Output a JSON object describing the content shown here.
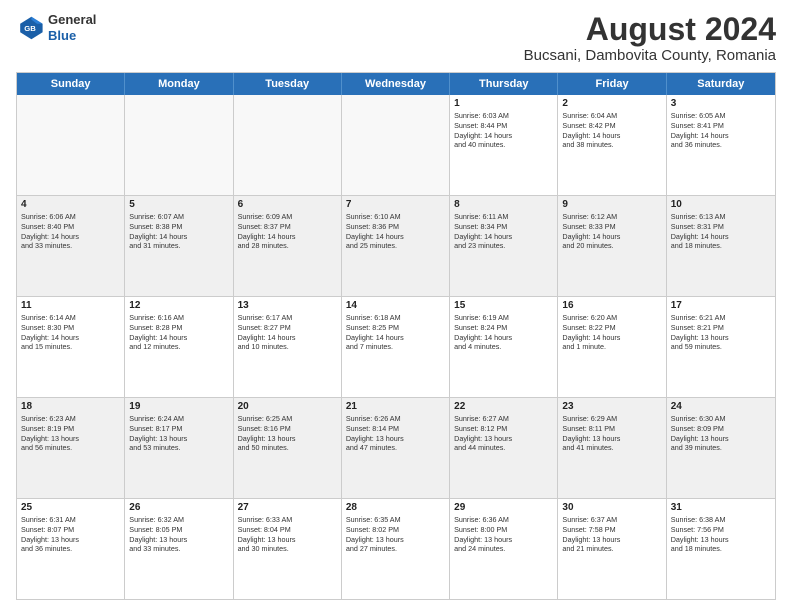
{
  "logo": {
    "line1": "General",
    "line2": "Blue"
  },
  "title": "August 2024",
  "subtitle": "Bucsani, Dambovita County, Romania",
  "header_days": [
    "Sunday",
    "Monday",
    "Tuesday",
    "Wednesday",
    "Thursday",
    "Friday",
    "Saturday"
  ],
  "weeks": [
    [
      {
        "day": "",
        "info": ""
      },
      {
        "day": "",
        "info": ""
      },
      {
        "day": "",
        "info": ""
      },
      {
        "day": "",
        "info": ""
      },
      {
        "day": "1",
        "info": "Sunrise: 6:03 AM\nSunset: 8:44 PM\nDaylight: 14 hours\nand 40 minutes."
      },
      {
        "day": "2",
        "info": "Sunrise: 6:04 AM\nSunset: 8:42 PM\nDaylight: 14 hours\nand 38 minutes."
      },
      {
        "day": "3",
        "info": "Sunrise: 6:05 AM\nSunset: 8:41 PM\nDaylight: 14 hours\nand 36 minutes."
      }
    ],
    [
      {
        "day": "4",
        "info": "Sunrise: 6:06 AM\nSunset: 8:40 PM\nDaylight: 14 hours\nand 33 minutes."
      },
      {
        "day": "5",
        "info": "Sunrise: 6:07 AM\nSunset: 8:38 PM\nDaylight: 14 hours\nand 31 minutes."
      },
      {
        "day": "6",
        "info": "Sunrise: 6:09 AM\nSunset: 8:37 PM\nDaylight: 14 hours\nand 28 minutes."
      },
      {
        "day": "7",
        "info": "Sunrise: 6:10 AM\nSunset: 8:36 PM\nDaylight: 14 hours\nand 25 minutes."
      },
      {
        "day": "8",
        "info": "Sunrise: 6:11 AM\nSunset: 8:34 PM\nDaylight: 14 hours\nand 23 minutes."
      },
      {
        "day": "9",
        "info": "Sunrise: 6:12 AM\nSunset: 8:33 PM\nDaylight: 14 hours\nand 20 minutes."
      },
      {
        "day": "10",
        "info": "Sunrise: 6:13 AM\nSunset: 8:31 PM\nDaylight: 14 hours\nand 18 minutes."
      }
    ],
    [
      {
        "day": "11",
        "info": "Sunrise: 6:14 AM\nSunset: 8:30 PM\nDaylight: 14 hours\nand 15 minutes."
      },
      {
        "day": "12",
        "info": "Sunrise: 6:16 AM\nSunset: 8:28 PM\nDaylight: 14 hours\nand 12 minutes."
      },
      {
        "day": "13",
        "info": "Sunrise: 6:17 AM\nSunset: 8:27 PM\nDaylight: 14 hours\nand 10 minutes."
      },
      {
        "day": "14",
        "info": "Sunrise: 6:18 AM\nSunset: 8:25 PM\nDaylight: 14 hours\nand 7 minutes."
      },
      {
        "day": "15",
        "info": "Sunrise: 6:19 AM\nSunset: 8:24 PM\nDaylight: 14 hours\nand 4 minutes."
      },
      {
        "day": "16",
        "info": "Sunrise: 6:20 AM\nSunset: 8:22 PM\nDaylight: 14 hours\nand 1 minute."
      },
      {
        "day": "17",
        "info": "Sunrise: 6:21 AM\nSunset: 8:21 PM\nDaylight: 13 hours\nand 59 minutes."
      }
    ],
    [
      {
        "day": "18",
        "info": "Sunrise: 6:23 AM\nSunset: 8:19 PM\nDaylight: 13 hours\nand 56 minutes."
      },
      {
        "day": "19",
        "info": "Sunrise: 6:24 AM\nSunset: 8:17 PM\nDaylight: 13 hours\nand 53 minutes."
      },
      {
        "day": "20",
        "info": "Sunrise: 6:25 AM\nSunset: 8:16 PM\nDaylight: 13 hours\nand 50 minutes."
      },
      {
        "day": "21",
        "info": "Sunrise: 6:26 AM\nSunset: 8:14 PM\nDaylight: 13 hours\nand 47 minutes."
      },
      {
        "day": "22",
        "info": "Sunrise: 6:27 AM\nSunset: 8:12 PM\nDaylight: 13 hours\nand 44 minutes."
      },
      {
        "day": "23",
        "info": "Sunrise: 6:29 AM\nSunset: 8:11 PM\nDaylight: 13 hours\nand 41 minutes."
      },
      {
        "day": "24",
        "info": "Sunrise: 6:30 AM\nSunset: 8:09 PM\nDaylight: 13 hours\nand 39 minutes."
      }
    ],
    [
      {
        "day": "25",
        "info": "Sunrise: 6:31 AM\nSunset: 8:07 PM\nDaylight: 13 hours\nand 36 minutes."
      },
      {
        "day": "26",
        "info": "Sunrise: 6:32 AM\nSunset: 8:05 PM\nDaylight: 13 hours\nand 33 minutes."
      },
      {
        "day": "27",
        "info": "Sunrise: 6:33 AM\nSunset: 8:04 PM\nDaylight: 13 hours\nand 30 minutes."
      },
      {
        "day": "28",
        "info": "Sunrise: 6:35 AM\nSunset: 8:02 PM\nDaylight: 13 hours\nand 27 minutes."
      },
      {
        "day": "29",
        "info": "Sunrise: 6:36 AM\nSunset: 8:00 PM\nDaylight: 13 hours\nand 24 minutes."
      },
      {
        "day": "30",
        "info": "Sunrise: 6:37 AM\nSunset: 7:58 PM\nDaylight: 13 hours\nand 21 minutes."
      },
      {
        "day": "31",
        "info": "Sunrise: 6:38 AM\nSunset: 7:56 PM\nDaylight: 13 hours\nand 18 minutes."
      }
    ]
  ]
}
